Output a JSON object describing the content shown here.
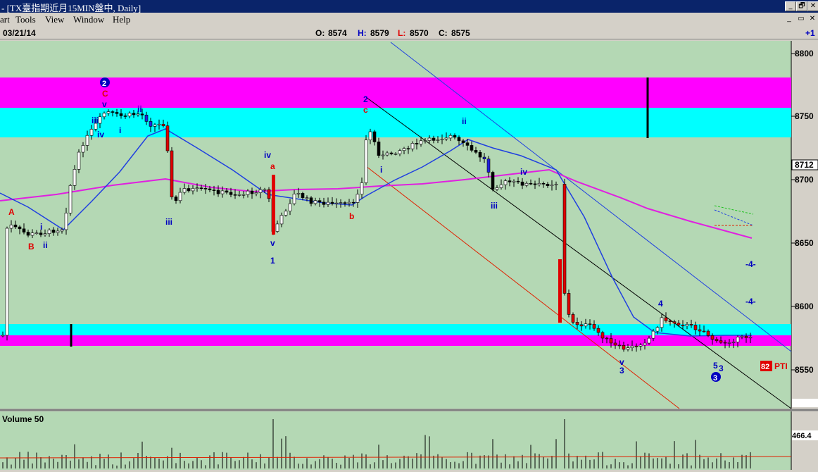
{
  "window": {
    "title": "- [TX臺指期近月15MIN盤中, Daily]",
    "minimize_label": "_",
    "restore_label": "🗗",
    "close_label": "✕"
  },
  "menu": {
    "items": [
      {
        "label": "art"
      },
      {
        "label": "Tools"
      },
      {
        "label": "View"
      },
      {
        "label": "Window"
      },
      {
        "label": "Help"
      }
    ]
  },
  "infobar": {
    "date": "03/21/14",
    "open_label": "O:",
    "open": "8574",
    "high_label": "H:",
    "high": "8579",
    "low_label": "L:",
    "low": "8570",
    "close_label": "C:",
    "close": "8575",
    "right": "+1"
  },
  "price_panel": {
    "ticks": [
      "8800",
      "8750",
      "8712",
      "8700",
      "8650",
      "8600",
      "8550"
    ],
    "current_price": "8712",
    "indicator_label": "PTI",
    "indicator_value": "82"
  },
  "volume_panel": {
    "title": "Volume 50",
    "value": "466.4"
  },
  "wave_labels": [
    {
      "text": "A",
      "color": "#e00000"
    },
    {
      "text": "B",
      "color": "#e00000"
    },
    {
      "text": "i",
      "color": "#0000c0"
    },
    {
      "text": "ii",
      "color": "#0000c0"
    },
    {
      "text": "2",
      "color": "#ffffff"
    },
    {
      "text": "C",
      "color": "#e00000"
    },
    {
      "text": "v",
      "color": "#0000c0"
    },
    {
      "text": "iii",
      "color": "#0000c0"
    },
    {
      "text": "iv",
      "color": "#0000c0"
    },
    {
      "text": "i",
      "color": "#0000c0"
    },
    {
      "text": "ii",
      "color": "#0000c0"
    },
    {
      "text": "iii",
      "color": "#0000c0"
    },
    {
      "text": "iv",
      "color": "#0000c0"
    },
    {
      "text": "a",
      "color": "#e00000"
    },
    {
      "text": "v",
      "color": "#0000c0"
    },
    {
      "text": "1",
      "color": "#0000c0"
    },
    {
      "text": "b",
      "color": "#e00000"
    },
    {
      "text": "2",
      "color": "#0000c0"
    },
    {
      "text": "c",
      "color": "#e00000"
    },
    {
      "text": "i",
      "color": "#0000c0"
    },
    {
      "text": "ii",
      "color": "#0000c0"
    },
    {
      "text": "iv",
      "color": "#0000c0"
    },
    {
      "text": "iii",
      "color": "#0000c0"
    },
    {
      "text": "4",
      "color": "#0000c0"
    },
    {
      "text": "v",
      "color": "#0000c0"
    },
    {
      "text": "3",
      "color": "#0000c0"
    },
    {
      "text": "5",
      "color": "#0000c0"
    },
    {
      "text": "3",
      "color": "#0000c0"
    },
    {
      "text": "3",
      "color": "#ffffff"
    },
    {
      "text": "-4-",
      "color": "#0000c0"
    },
    {
      "text": "-4-",
      "color": "#0000c0"
    }
  ],
  "colors": {
    "background": "#b4d8b4",
    "magenta_zone": "#ff00ff",
    "cyan_zone": "#00ffff",
    "up_candle": "#ffffff",
    "down_candle_black": "#000000",
    "down_candle_red": "#e00000",
    "down_candle_blue": "#2020e0",
    "ma_magenta": "#e020e0",
    "ma_blue": "#2040e0"
  }
}
